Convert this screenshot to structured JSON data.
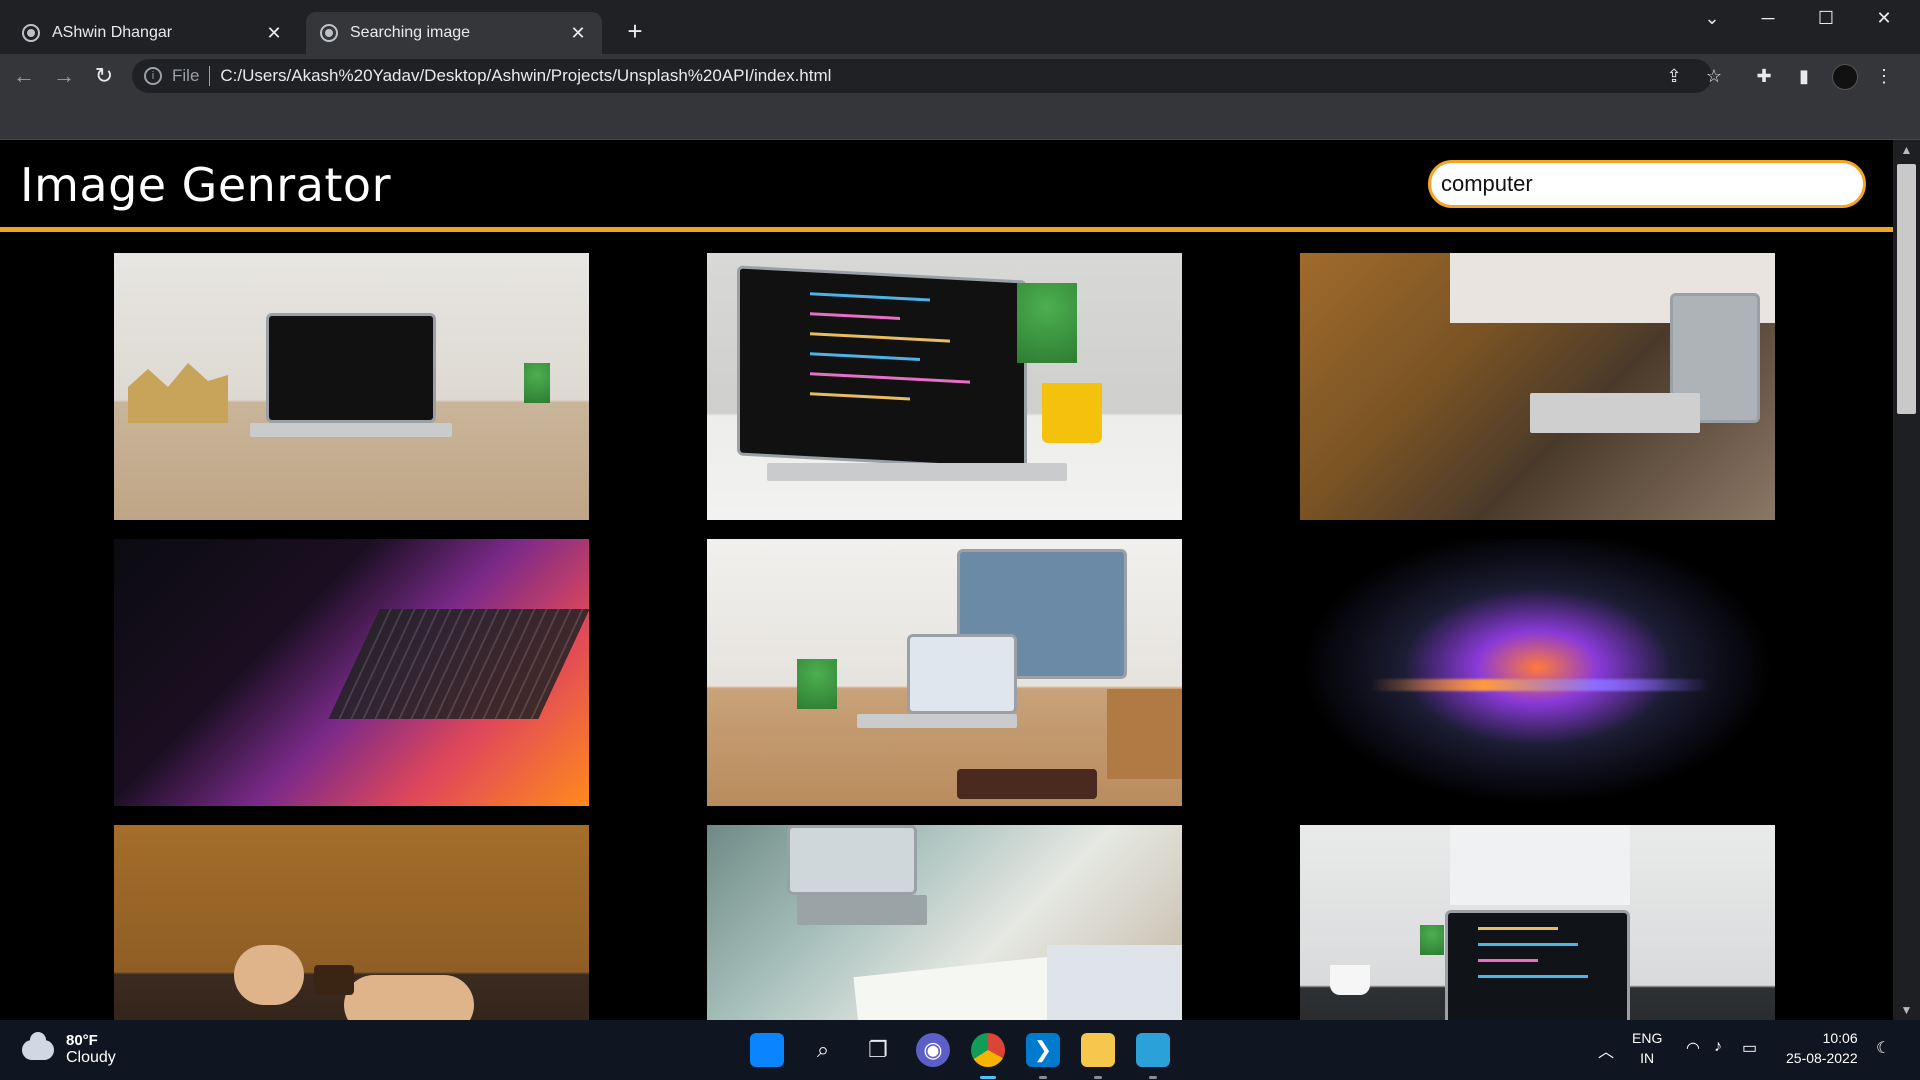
{
  "browser": {
    "tabs": [
      {
        "title": "AShwin Dhangar",
        "active": false
      },
      {
        "title": "Searching image",
        "active": true
      }
    ],
    "new_tab_icon": "plus-icon",
    "window_controls": [
      "chevron-down-icon",
      "minimize-icon",
      "maximize-icon",
      "close-icon"
    ],
    "address": {
      "scheme": "File",
      "url": "C:/Users/Akash%20Yadav/Desktop/Ashwin/Projects/Unsplash%20API/index.html"
    }
  },
  "page": {
    "site_title": "Image Genrator",
    "search": {
      "value": "computer"
    },
    "accent_color": "#f4a424",
    "images": [
      {
        "alt": "laptop on wooden desk"
      },
      {
        "alt": "laptop with code editor"
      },
      {
        "alt": "person typing on laptop"
      },
      {
        "alt": "glowing laptop keyboard"
      },
      {
        "alt": "desk with monitor and laptop"
      },
      {
        "alt": "laptop in dark with light"
      },
      {
        "alt": "person in sweater at laptop"
      },
      {
        "alt": "people writing notes near laptop"
      },
      {
        "alt": "laptop with code on desk"
      }
    ]
  },
  "taskbar": {
    "weather": {
      "temp": "80°F",
      "condition": "Cloudy"
    },
    "language": {
      "line1": "ENG",
      "line2": "IN"
    },
    "time": "10:06",
    "date": "25-08-2022"
  }
}
